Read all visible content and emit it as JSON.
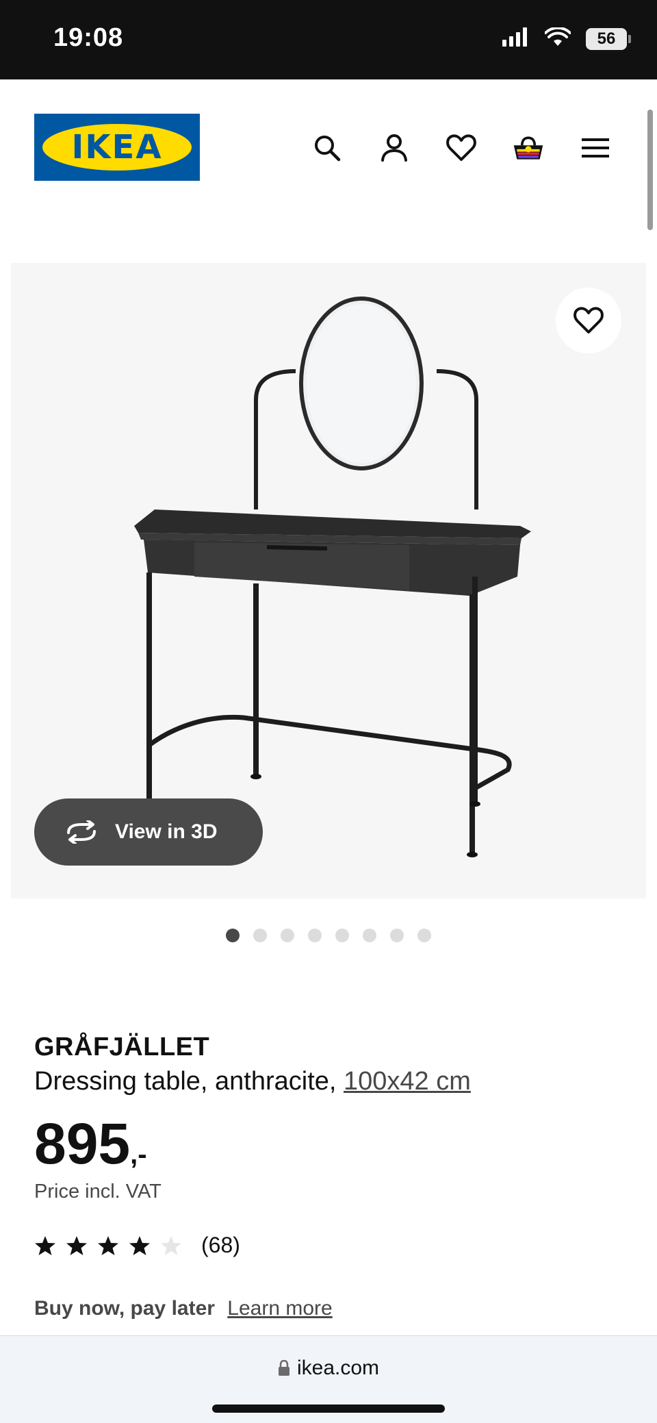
{
  "status_bar": {
    "time": "19:08",
    "battery": "56"
  },
  "header": {
    "logo_text": "IKEA",
    "icons": [
      "search-icon",
      "account-icon",
      "wishlist-heart-icon",
      "shopping-basket-icon",
      "menu-icon"
    ]
  },
  "product_image": {
    "view3d_label": "View in 3D",
    "carousel_count": 8,
    "carousel_active": 1
  },
  "product": {
    "name": "GRÅFJÄLLET",
    "description": "Dressing table, anthracite,",
    "dimensions": "100x42 cm",
    "price": "895",
    "price_suffix": ",-",
    "vat_note": "Price incl. VAT",
    "rating": {
      "stars": 4,
      "max": 5,
      "count": "(68)"
    },
    "bnpl_label": "Buy now, pay later",
    "bnpl_link": "Learn more"
  },
  "browser": {
    "url": "ikea.com"
  },
  "colors": {
    "ikea_blue": "#0058a3",
    "ikea_yellow": "#ffdb00",
    "text": "#111111",
    "muted": "#484848"
  }
}
